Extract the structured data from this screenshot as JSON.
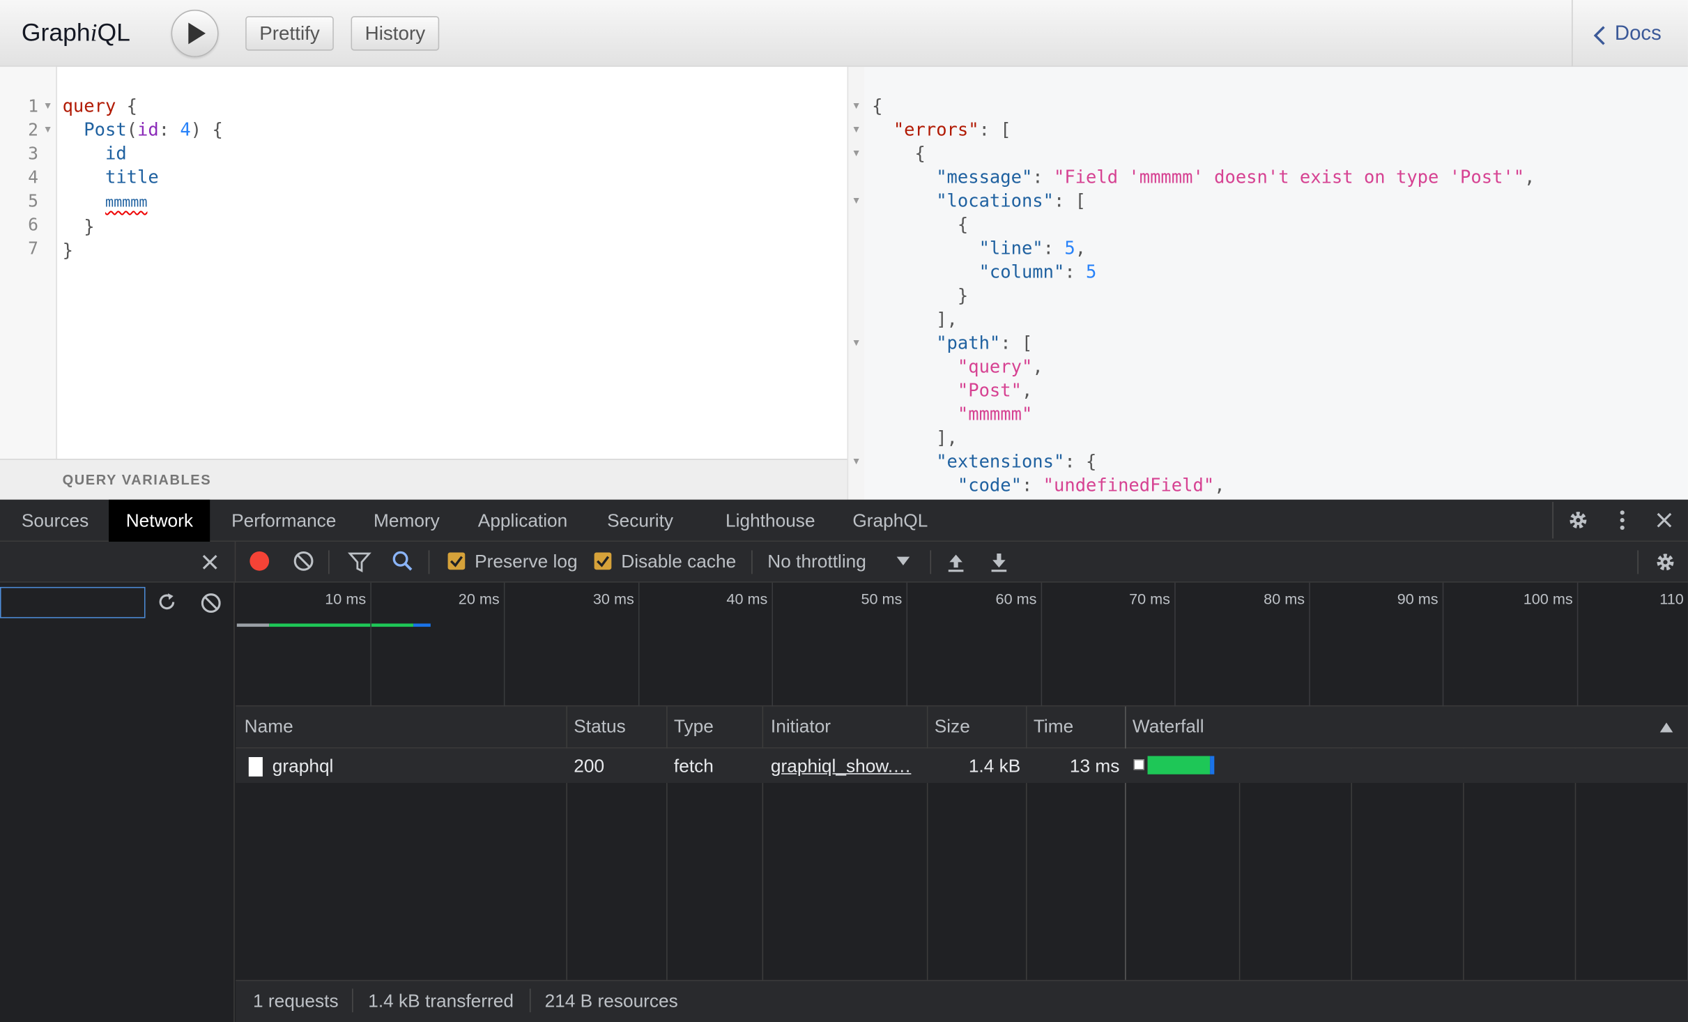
{
  "graphiql": {
    "title_prefix": "Graph",
    "title_italic": "i",
    "title_suffix": "QL",
    "prettify_label": "Prettify",
    "history_label": "History",
    "docs_label": "Docs",
    "query_variables_label": "QUERY VARIABLES",
    "query_lines": [
      {
        "num": "1",
        "fold": true
      },
      {
        "num": "2",
        "fold": true
      },
      {
        "num": "3"
      },
      {
        "num": "4"
      },
      {
        "num": "5"
      },
      {
        "num": "6"
      },
      {
        "num": "7"
      }
    ],
    "query": {
      "kw": "query",
      "brace_open": "{",
      "field": "Post",
      "arg": "id",
      "arg_value": "4",
      "f1": "id",
      "f2": "title",
      "f3": "mmmmm",
      "brace_close": "}"
    },
    "result": {
      "errors_key": "\"errors\"",
      "message_key": "\"message\"",
      "message_value": "\"Field 'mmmmm' doesn't exist on type 'Post'\"",
      "locations_key": "\"locations\"",
      "line_key": "\"line\"",
      "line_value": "5",
      "column_key": "\"column\"",
      "column_value": "5",
      "path_key": "\"path\"",
      "path_0": "\"query\"",
      "path_1": "\"Post\"",
      "path_2": "\"mmmmm\"",
      "extensions_key": "\"extensions\"",
      "code_key": "\"code\"",
      "code_value": "\"undefinedField\""
    }
  },
  "devtools": {
    "tabs": [
      "Sources",
      "Network",
      "Performance",
      "Memory",
      "Application",
      "Security",
      "Lighthouse",
      "GraphQL"
    ],
    "active_tab": "Network",
    "preserve_log_label": "Preserve log",
    "preserve_log_checked": true,
    "disable_cache_label": "Disable cache",
    "disable_cache_checked": true,
    "throttling_value": "No throttling",
    "timeline_ticks": [
      "10 ms",
      "20 ms",
      "30 ms",
      "40 ms",
      "50 ms",
      "60 ms",
      "70 ms",
      "80 ms",
      "90 ms",
      "100 ms",
      "110"
    ],
    "columns": [
      "Name",
      "Status",
      "Type",
      "Initiator",
      "Size",
      "Time",
      "Waterfall"
    ],
    "rows": [
      {
        "name": "graphql",
        "status": "200",
        "type": "fetch",
        "initiator": "graphiql_show.…",
        "size": "1.4 kB",
        "time": "13 ms"
      }
    ],
    "status_bar": {
      "requests": "1 requests",
      "transferred": "1.4 kB transferred",
      "resources": "214 B resources"
    },
    "colors": {
      "record": "#f44336",
      "accent": "#8ab4f8",
      "waterfall_green": "#1ec757",
      "waterfall_blue": "#1a73e8"
    }
  }
}
